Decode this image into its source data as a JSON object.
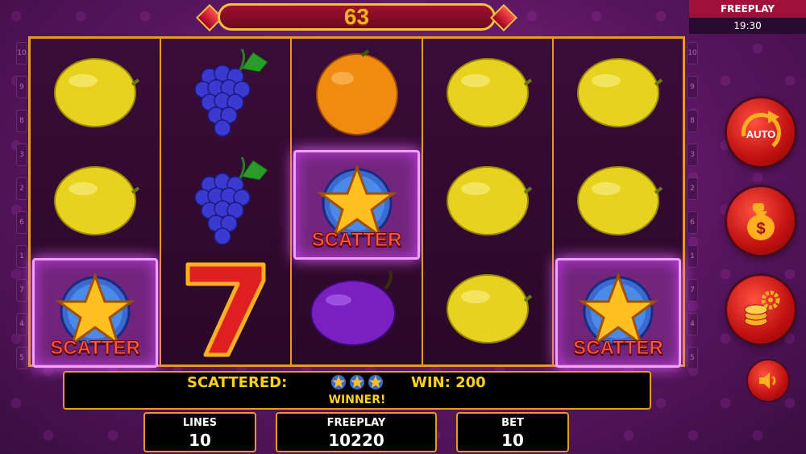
{
  "top_counter": {
    "value": "63"
  },
  "freeplay_panel": {
    "title": "FREEPLAY",
    "time": "19:30"
  },
  "line_markers_left": [
    "10",
    "9",
    "8",
    "3",
    "2",
    "6",
    "1",
    "7",
    "4",
    "5"
  ],
  "line_markers_right": [
    "10",
    "9",
    "8",
    "3",
    "2",
    "6",
    "1",
    "7",
    "4",
    "5"
  ],
  "reels": [
    [
      "lemon",
      "lemon",
      "scatter"
    ],
    [
      "grapes",
      "grapes",
      "seven"
    ],
    [
      "orange",
      "scatter",
      "plum"
    ],
    [
      "lemon",
      "lemon",
      "lemon"
    ],
    [
      "lemon",
      "lemon",
      "scatter"
    ]
  ],
  "scatter_label": "SCATTER",
  "info": {
    "scattered_label": "SCATTERED:",
    "scatter_count": 3,
    "win_label": "WIN: 200",
    "winner_label": "WINNER!"
  },
  "bottom": {
    "lines": {
      "label": "LINES",
      "value": "10"
    },
    "freeplay": {
      "label": "FREEPLAY",
      "value": "10220"
    },
    "bet": {
      "label": "BET",
      "value": "10"
    }
  },
  "buttons": {
    "auto": "AUTO",
    "collect_icon": "money-bag-icon",
    "settings_icon": "coins-gear-icon",
    "sound_icon": "speaker-icon"
  },
  "colors": {
    "accent": "#e89a20",
    "highlight": "#f0a0ff",
    "text_gold": "#ffd020"
  }
}
